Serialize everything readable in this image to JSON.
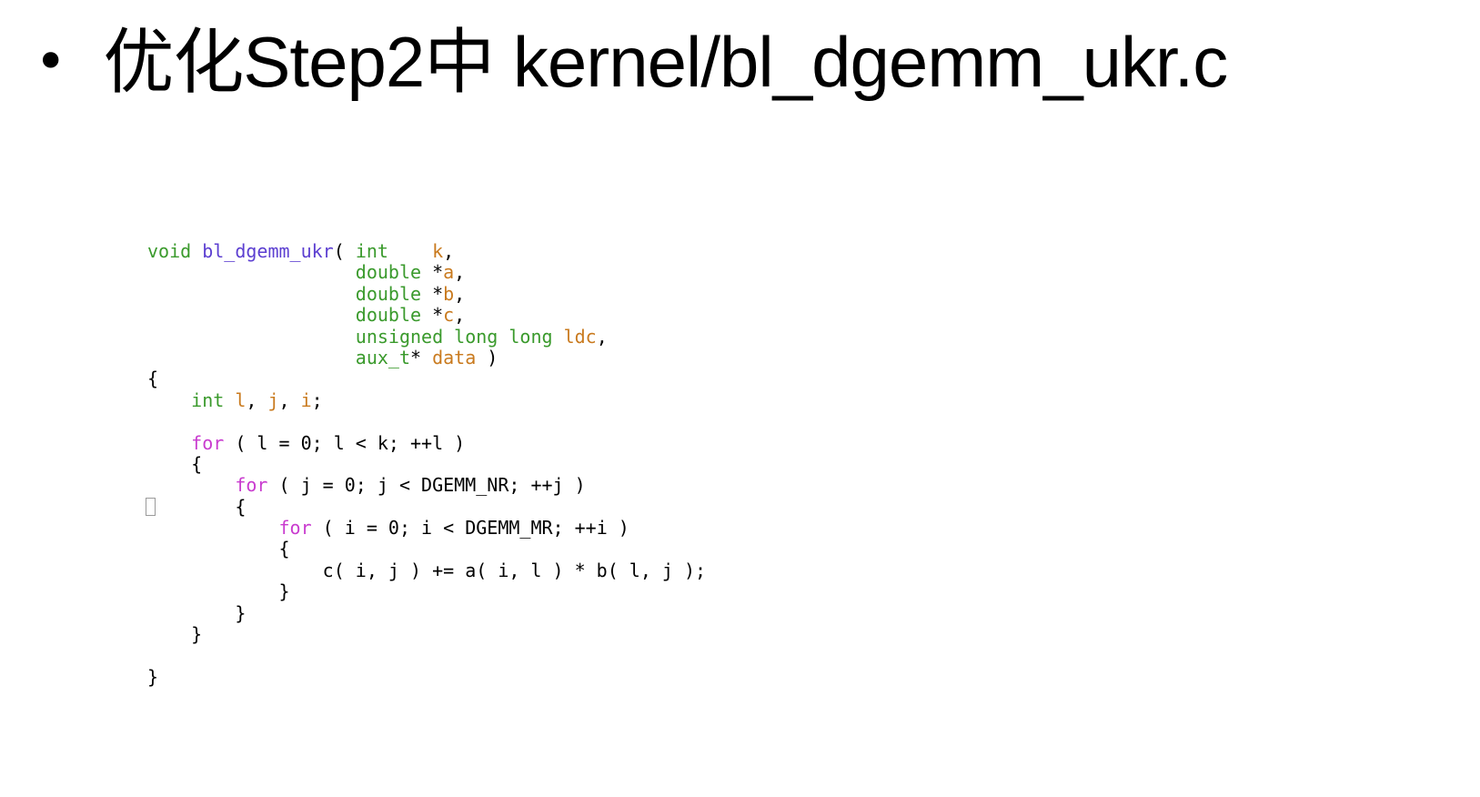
{
  "slide": {
    "bullet": "•",
    "title": "优化Step2中  kernel/bl_dgemm_ukr.c"
  },
  "colors": {
    "type": "#3a9a2c",
    "function": "#5c3fd1",
    "variable": "#c97a1e",
    "keyword": "#c93ccf",
    "plain": "#000000"
  },
  "code": {
    "lines": [
      [
        {
          "t": "type",
          "s": "void"
        },
        {
          "t": "plain",
          "s": " "
        },
        {
          "t": "fn",
          "s": "bl_dgemm_ukr"
        },
        {
          "t": "plain",
          "s": "( "
        },
        {
          "t": "type",
          "s": "int"
        },
        {
          "t": "plain",
          "s": "    "
        },
        {
          "t": "var",
          "s": "k"
        },
        {
          "t": "plain",
          "s": ","
        }
      ],
      [
        {
          "t": "plain",
          "s": "                   "
        },
        {
          "t": "type",
          "s": "double"
        },
        {
          "t": "plain",
          "s": " *"
        },
        {
          "t": "var",
          "s": "a"
        },
        {
          "t": "plain",
          "s": ","
        }
      ],
      [
        {
          "t": "plain",
          "s": "                   "
        },
        {
          "t": "type",
          "s": "double"
        },
        {
          "t": "plain",
          "s": " *"
        },
        {
          "t": "var",
          "s": "b"
        },
        {
          "t": "plain",
          "s": ","
        }
      ],
      [
        {
          "t": "plain",
          "s": "                   "
        },
        {
          "t": "type",
          "s": "double"
        },
        {
          "t": "plain",
          "s": " *"
        },
        {
          "t": "var",
          "s": "c"
        },
        {
          "t": "plain",
          "s": ","
        }
      ],
      [
        {
          "t": "plain",
          "s": "                   "
        },
        {
          "t": "type",
          "s": "unsigned long long"
        },
        {
          "t": "plain",
          "s": " "
        },
        {
          "t": "var",
          "s": "ldc"
        },
        {
          "t": "plain",
          "s": ","
        }
      ],
      [
        {
          "t": "plain",
          "s": "                   "
        },
        {
          "t": "type",
          "s": "aux_t"
        },
        {
          "t": "plain",
          "s": "* "
        },
        {
          "t": "var",
          "s": "data"
        },
        {
          "t": "plain",
          "s": " )"
        }
      ],
      [
        {
          "t": "plain",
          "s": "{"
        }
      ],
      [
        {
          "t": "plain",
          "s": "    "
        },
        {
          "t": "type",
          "s": "int"
        },
        {
          "t": "plain",
          "s": " "
        },
        {
          "t": "var",
          "s": "l"
        },
        {
          "t": "plain",
          "s": ", "
        },
        {
          "t": "var",
          "s": "j"
        },
        {
          "t": "plain",
          "s": ", "
        },
        {
          "t": "var",
          "s": "i"
        },
        {
          "t": "plain",
          "s": ";"
        }
      ],
      [],
      [
        {
          "t": "plain",
          "s": "    "
        },
        {
          "t": "kw",
          "s": "for"
        },
        {
          "t": "plain",
          "s": " ( l = 0; l < k; ++l )"
        }
      ],
      [
        {
          "t": "plain",
          "s": "    {"
        }
      ],
      [
        {
          "t": "plain",
          "s": "        "
        },
        {
          "t": "kw",
          "s": "for"
        },
        {
          "t": "plain",
          "s": " ( j = 0; j < DGEMM_NR; ++j )"
        }
      ],
      [
        {
          "t": "plain",
          "s": "        {"
        }
      ],
      [
        {
          "t": "plain",
          "s": "            "
        },
        {
          "t": "kw",
          "s": "for"
        },
        {
          "t": "plain",
          "s": " ( i = 0; i < DGEMM_MR; ++i )"
        }
      ],
      [
        {
          "t": "plain",
          "s": "            {"
        }
      ],
      [
        {
          "t": "plain",
          "s": "                c( i, j ) += a( i, l ) * b( l, j );"
        }
      ],
      [
        {
          "t": "plain",
          "s": "            }"
        }
      ],
      [
        {
          "t": "plain",
          "s": "        }"
        }
      ],
      [
        {
          "t": "plain",
          "s": "    }"
        }
      ],
      [],
      [
        {
          "t": "plain",
          "s": "}"
        }
      ]
    ]
  }
}
